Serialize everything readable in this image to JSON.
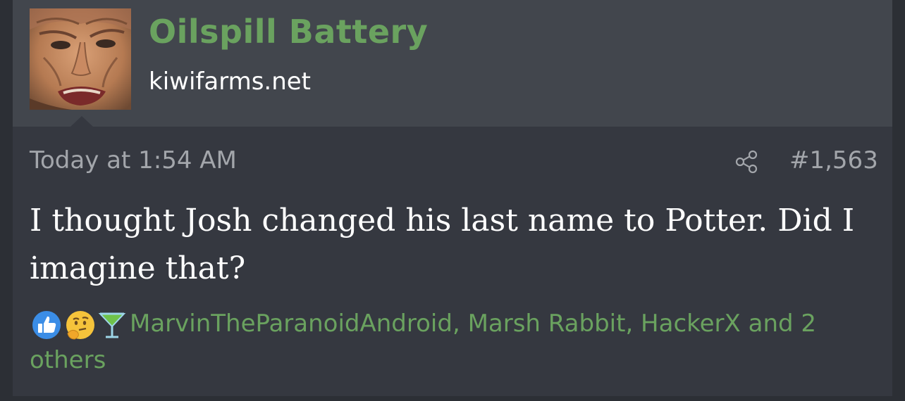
{
  "post": {
    "username": "Oilspill Battery",
    "site": "kiwifarms.net",
    "timestamp": "Today at 1:54 AM",
    "post_number": "#1,563",
    "body": "I thought Josh changed his last name to Potter. Did I imagine that?",
    "reactions": {
      "icons": [
        "thumbs-up-icon",
        "thinking-face-icon",
        "cocktail-icon"
      ],
      "text": "MarvinTheParanoidAndroid, Marsh Rabbit, HackerX and 2 others"
    }
  },
  "colors": {
    "accent_green": "#6aa25f",
    "header_bg": "#42464d",
    "post_bg": "#353840",
    "meta_gray": "#a3a6ab"
  }
}
